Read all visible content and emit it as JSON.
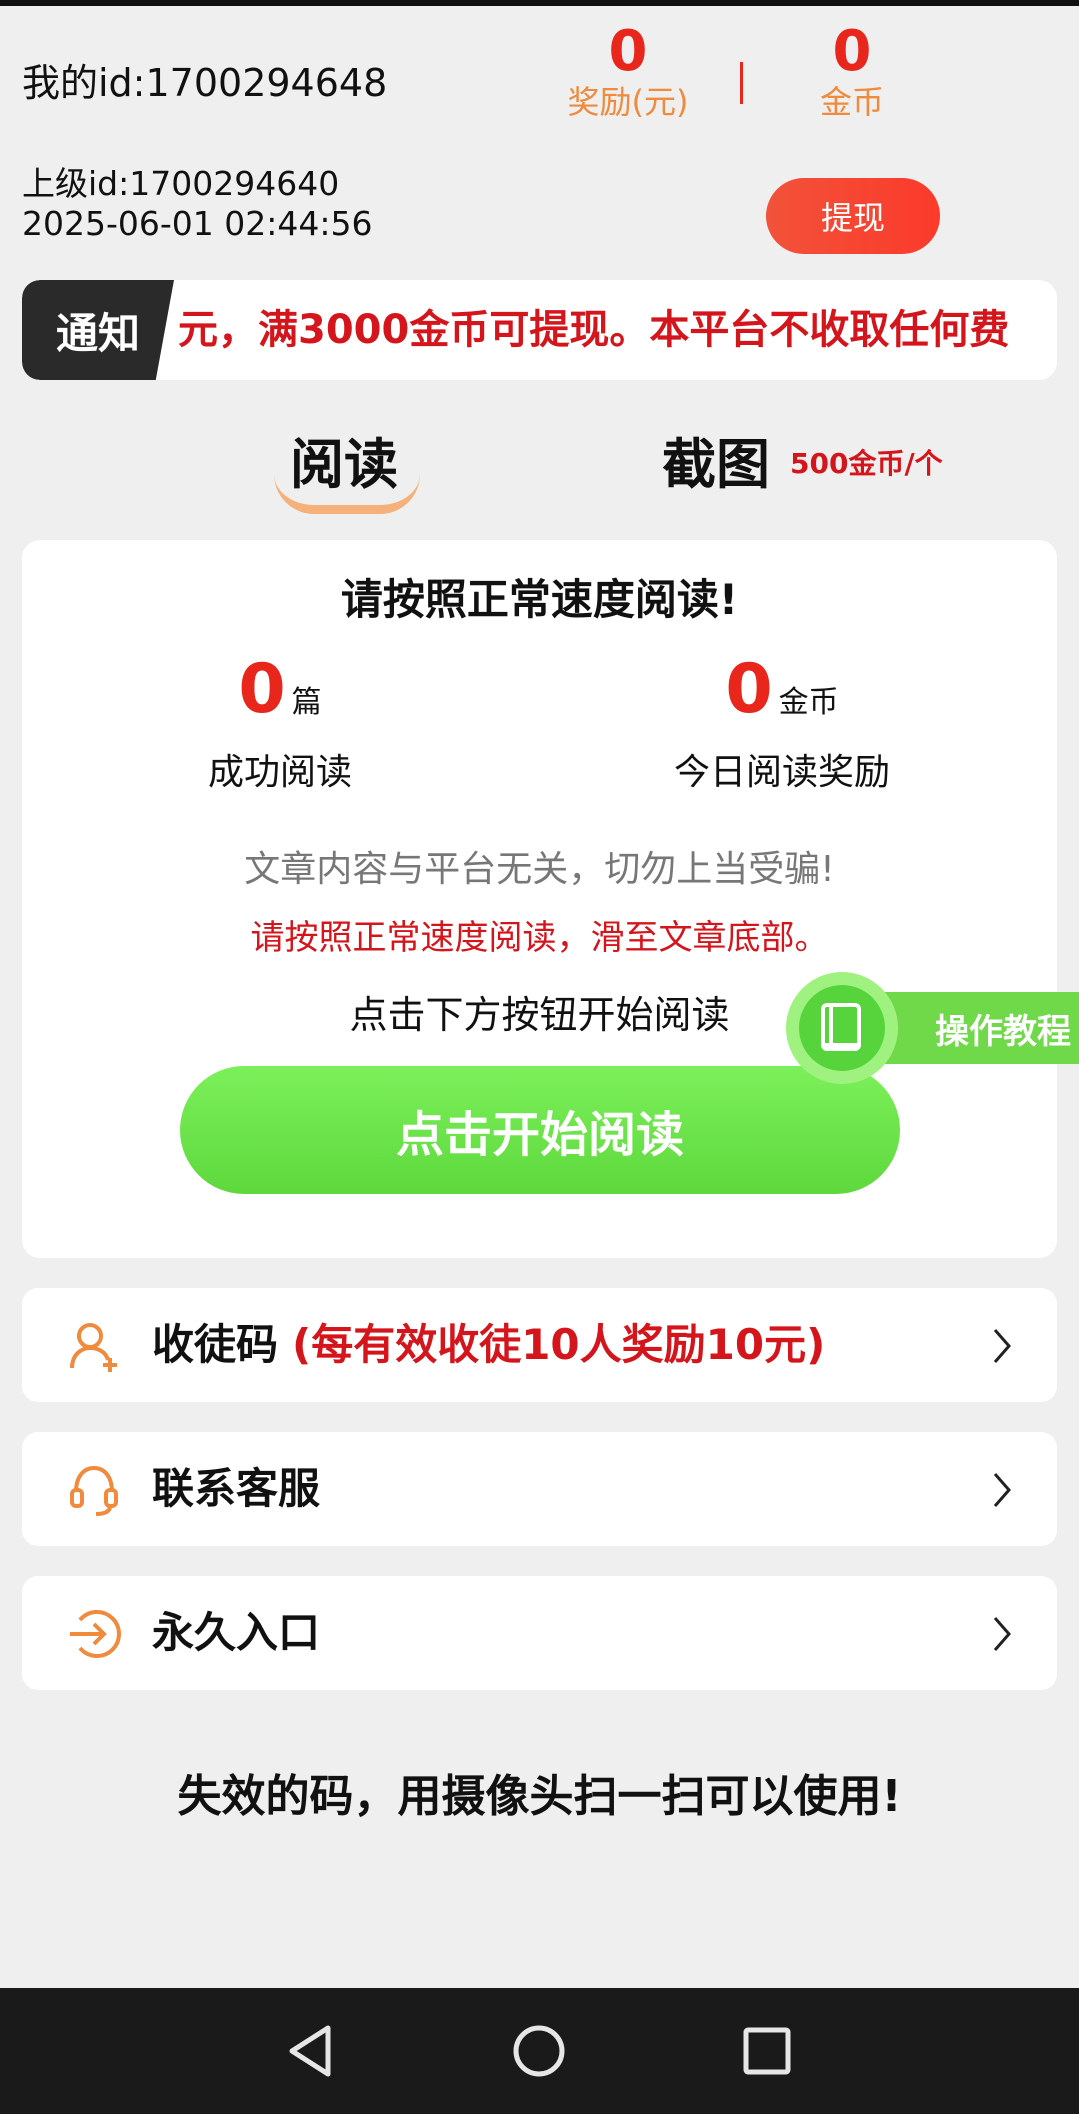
{
  "header": {
    "my_id": "我的id:1700294648",
    "superior_id": "上级id:1700294640",
    "timestamp": "2025-06-01 02:44:56",
    "reward_value": "0",
    "reward_label": "奖励(元)",
    "coins_value": "0",
    "coins_label": "金币",
    "withdraw_label": "提现"
  },
  "notice": {
    "tag": "通知",
    "text": "元，满3000金币可提现。本平台不收取任何费"
  },
  "tabs": [
    {
      "label": "阅读",
      "active": true
    },
    {
      "label": "截图",
      "price": "500金币/个"
    }
  ],
  "read_card": {
    "title": "请按照正常速度阅读!",
    "articles_value": "0",
    "articles_unit": "篇",
    "articles_caption": "成功阅读",
    "coins_value": "0",
    "coins_unit": "金币",
    "coins_caption": "今日阅读奖励",
    "warning_grey": "文章内容与平台无关，切勿上当受骗!",
    "warning_red": "请按照正常速度阅读，滑至文章底部。",
    "hint": "点击下方按钮开始阅读",
    "start_button": "点击开始阅读"
  },
  "tutorial": {
    "label": "操作教程"
  },
  "rows": [
    {
      "label": "收徒码",
      "note": "(每有效收徒10人奖励10元)",
      "icon": "user-add-icon"
    },
    {
      "label": "联系客服",
      "note": "",
      "icon": "headset-icon"
    },
    {
      "label": "永久入口",
      "note": "",
      "icon": "enter-icon"
    }
  ],
  "bottom_message": "失效的码，用摄像头扫一扫可以使用!",
  "colors": {
    "accent_red": "#e8261b",
    "accent_orange": "#f08a3c",
    "accent_green": "#6fd94a",
    "background": "#efefef"
  }
}
